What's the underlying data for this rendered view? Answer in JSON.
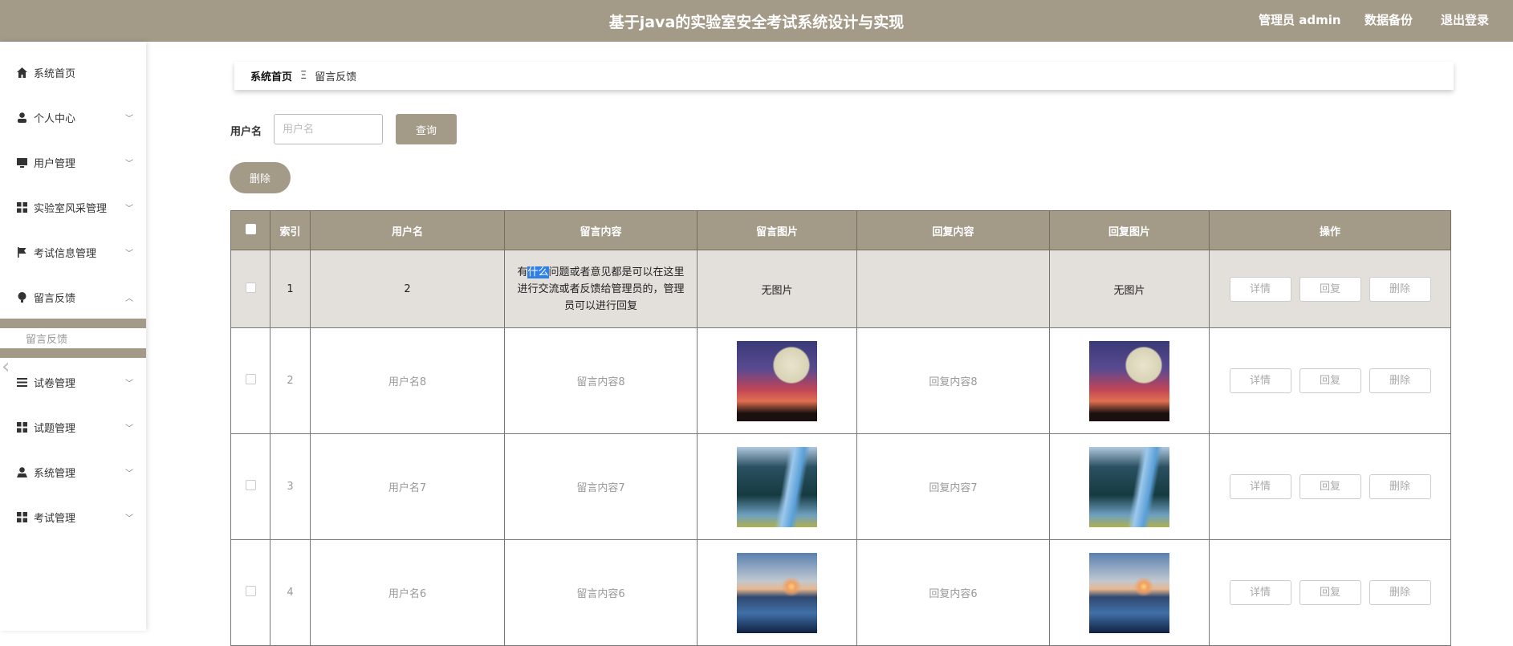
{
  "header": {
    "title": "基于java的实验室安全考试系统设计与实现",
    "user": "管理员 admin",
    "backup": "数据备份",
    "logout": "退出登录"
  },
  "sidebar": {
    "items": [
      {
        "label": "系统首页",
        "icon": "home-icon"
      },
      {
        "label": "个人中心",
        "icon": "user-icon"
      },
      {
        "label": "用户管理",
        "icon": "monitor-icon"
      },
      {
        "label": "实验室风采管理",
        "icon": "grid-icon"
      },
      {
        "label": "考试信息管理",
        "icon": "flag-icon"
      },
      {
        "label": "留言反馈",
        "icon": "bulb-icon"
      },
      {
        "label": "试卷管理",
        "icon": "list-icon"
      },
      {
        "label": "试题管理",
        "icon": "grid-icon"
      },
      {
        "label": "系统管理",
        "icon": "user-icon"
      },
      {
        "label": "考试管理",
        "icon": "grid-icon"
      }
    ],
    "sub": "留言反馈"
  },
  "breadcrumb": {
    "home": "系统首页",
    "sep": "Ξ",
    "current": "留言反馈"
  },
  "search": {
    "label": "用户名",
    "placeholder": "用户名",
    "query": "查询",
    "delete": "删除"
  },
  "table": {
    "headers": [
      "索引",
      "用户名",
      "留言内容",
      "留言图片",
      "回复内容",
      "回复图片",
      "操作"
    ],
    "actions": [
      "详情",
      "回复",
      "删除"
    ],
    "row1": {
      "index": "1",
      "user": "2",
      "content_a": "有",
      "content_hl": "什么",
      "content_b": "问题或者意见都是可以在这里进行交流或者反馈给管理员的，管理员可以进行回复",
      "img": "无图片",
      "reply": "",
      "reply_img": "无图片"
    },
    "rows": [
      {
        "index": "2",
        "user": "用户名8",
        "content": "留言内容8",
        "reply": "回复内容8"
      },
      {
        "index": "3",
        "user": "用户名7",
        "content": "留言内容7",
        "reply": "回复内容7"
      },
      {
        "index": "4",
        "user": "用户名6",
        "content": "留言内容6",
        "reply": "回复内容6"
      }
    ]
  }
}
